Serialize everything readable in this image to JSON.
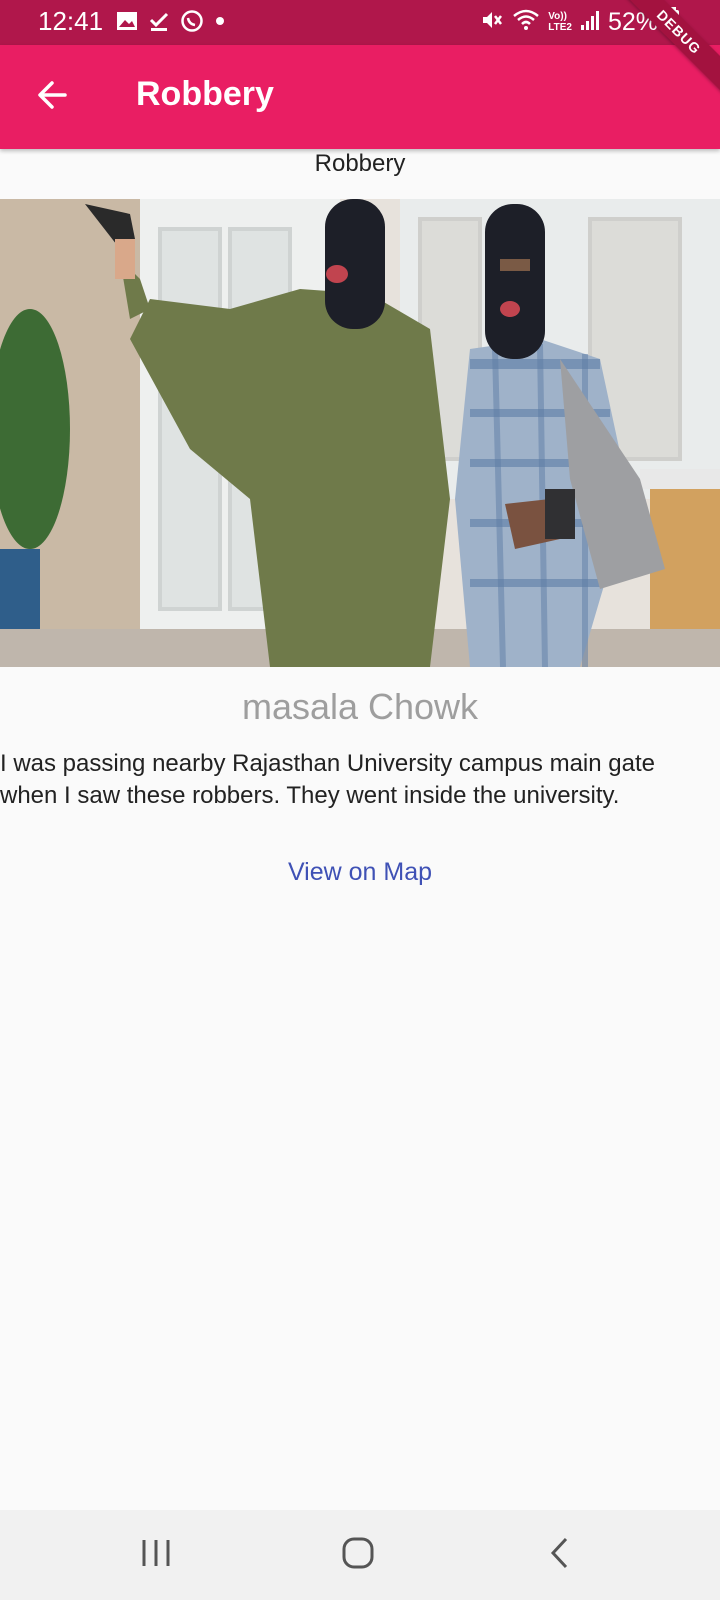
{
  "status_bar": {
    "time": "12:41",
    "battery": "52%",
    "left_icons": [
      "gallery-icon",
      "check-icon",
      "whatsapp-icon",
      "dot-icon"
    ],
    "right_icons": [
      "mute-icon",
      "wifi-icon",
      "volte-icon",
      "signal-icon",
      "battery-icon"
    ],
    "network_label": "Vo))\nLTE2"
  },
  "debug_banner": "DEBUG",
  "app_bar": {
    "title": "Robbery",
    "back_icon": "arrow-left-icon"
  },
  "report": {
    "category": "Robbery",
    "location": "masala Chowk",
    "description": "I was passing nearby Rajasthan University campus main gate when I saw these robbers. They went inside the university.",
    "map_link": "View on Map"
  },
  "nav_bar": {
    "buttons": [
      "recent-apps-icon",
      "home-icon",
      "back-icon"
    ]
  },
  "colors": {
    "status_bar": "#b0174b",
    "app_bar": "#e91e63",
    "link": "#3f51b5",
    "location_text": "#9e9e9e"
  }
}
